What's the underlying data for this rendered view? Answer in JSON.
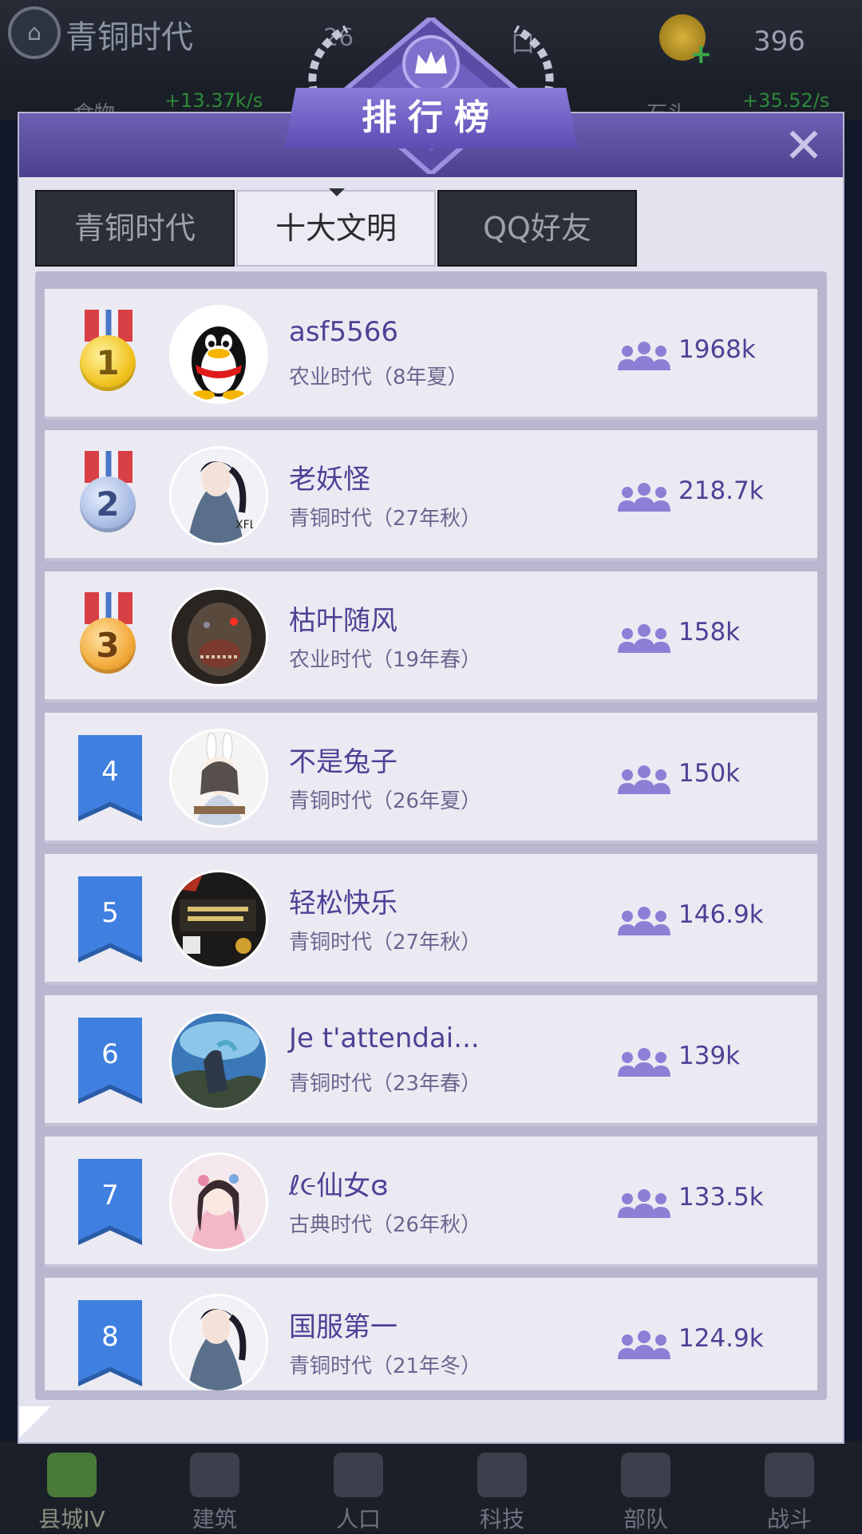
{
  "hud": {
    "era": "青铜时代",
    "pop_partial": "26",
    "pop_partial_r": "口",
    "coins": "396",
    "food_label": "食物",
    "food_rate": "+13.37k/s",
    "stone_label": "石头",
    "stone_rate": "+35.52/s"
  },
  "dialog": {
    "title": "排行榜",
    "close": "✕"
  },
  "tabs": [
    {
      "label": "青铜时代"
    },
    {
      "label": "十大文明"
    },
    {
      "label": "QQ好友"
    }
  ],
  "active_tab": "十大文明",
  "rankings": [
    {
      "rank": "1",
      "name": "asf5566",
      "era": "农业时代（8年夏）",
      "score": "1968k"
    },
    {
      "rank": "2",
      "name": "老妖怪",
      "era": "青铜时代（27年秋）",
      "score": "218.7k"
    },
    {
      "rank": "3",
      "name": "枯叶随风",
      "era": "农业时代（19年春）",
      "score": "158k"
    },
    {
      "rank": "4",
      "name": "不是兔子",
      "era": "青铜时代（26年夏）",
      "score": "150k"
    },
    {
      "rank": "5",
      "name": "轻松快乐",
      "era": "青铜时代（27年秋）",
      "score": "146.9k"
    },
    {
      "rank": "6",
      "name": "Je t'attendai...",
      "era": "青铜时代（23年春）",
      "score": "139k"
    },
    {
      "rank": "7",
      "name": "仙女",
      "era": "古典时代（26年秋）",
      "score": "133.5k"
    },
    {
      "rank": "8",
      "name": "国服第一",
      "era": "青铜时代（21年冬）",
      "score": "124.9k"
    }
  ],
  "icons": {
    "medal_1": "gold-medal-icon",
    "medal_2": "silver-medal-icon",
    "medal_3": "bronze-medal-icon",
    "people": "people-icon",
    "close": "close-icon"
  },
  "bottom_nav": [
    {
      "label": "县城IV",
      "icon": "castle-icon"
    },
    {
      "label": "建筑",
      "icon": "house-icon"
    },
    {
      "label": "人口",
      "icon": "person-icon"
    },
    {
      "label": "科技",
      "icon": "book-icon"
    },
    {
      "label": "部队",
      "icon": "banner-icon"
    },
    {
      "label": "战斗",
      "icon": "swords-icon"
    }
  ],
  "colors": {
    "accent": "#5a4a95",
    "header": "#6d60b4",
    "flag_blue": "#3f7fe0"
  }
}
